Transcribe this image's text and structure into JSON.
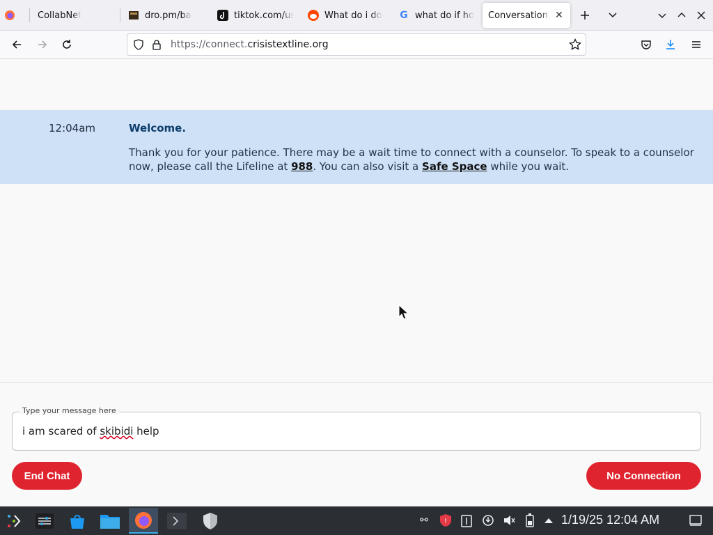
{
  "browser": {
    "tabs": [
      {
        "label": "CollabNet",
        "icon": "firefox-icon"
      },
      {
        "label": "dro.pm/ba",
        "icon": "site-thumbnail-icon"
      },
      {
        "label": "tiktok.com/us",
        "icon": "tiktok-icon"
      },
      {
        "label": "What do i do",
        "icon": "reddit-icon"
      },
      {
        "label": "what do if ho",
        "icon": "google-icon"
      },
      {
        "label": "Conversation v",
        "icon": "none",
        "active": true
      }
    ],
    "url_prefix": "https://connect.",
    "url_domain": "crisistextline.org"
  },
  "chat": {
    "messages": [
      {
        "time": "12:04am",
        "title": "Welcome.",
        "body_1": "Thank you for your patience. There may be a wait time to connect with a counselor. To speak to a counselor now, please call the Lifeline at ",
        "link_988": "988",
        "body_2": ". You can also visit a ",
        "link_safe": "Safe Space",
        "body_3": " while you wait."
      }
    ],
    "input_label": "Type your message here",
    "input_value_pre": "i am scared of ",
    "input_value_misspelled": "skibidi",
    "input_value_post": " help",
    "end_button": "End Chat",
    "status_button": "No Connection"
  },
  "colors": {
    "accent_red": "#e0242f",
    "message_band": "#cfe1f7",
    "message_title": "#0b3d6b"
  },
  "taskbar": {
    "clock": "1/19/25 12:04 AM",
    "apps": [
      "app-launcher-icon",
      "settings-icon",
      "store-icon",
      "file-manager-icon",
      "firefox-icon",
      "terminal-icon",
      "shield-icon"
    ]
  }
}
